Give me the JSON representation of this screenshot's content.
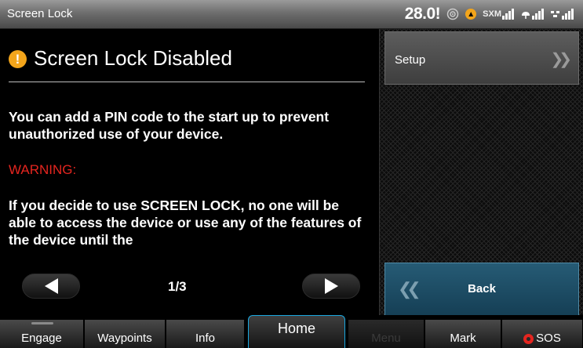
{
  "status": {
    "title": "Screen Lock",
    "clock": "28.0!",
    "sxm_label": "SXM"
  },
  "content": {
    "title": "Screen Lock Disabled",
    "paragraph1": "You can add a PIN code to the start up to prevent unauthorized use of your device.",
    "warning": "WARNING:",
    "paragraph2": "If you decide to use SCREEN LOCK, no one will be able to access the device or use any of the features of the device until the",
    "page_indicator": "1/3"
  },
  "side": {
    "setup_label": "Setup",
    "back_label": "Back"
  },
  "nav": {
    "engage": "Engage",
    "waypoints": "Waypoints",
    "info": "Info",
    "home": "Home",
    "menu": "Menu",
    "mark": "Mark",
    "sos": "SOS"
  },
  "colors": {
    "warning": "#e5251f",
    "alert": "#f3a51b",
    "back_button": "#1e4e66",
    "active_tab_border": "#19a8e0"
  },
  "icons": [
    "alert-icon",
    "gps-icon",
    "signal-icon",
    "weather-icon",
    "chevron-right-icon",
    "chevron-left-icon",
    "arrow-left-icon",
    "arrow-right-icon",
    "sos-icon"
  ]
}
